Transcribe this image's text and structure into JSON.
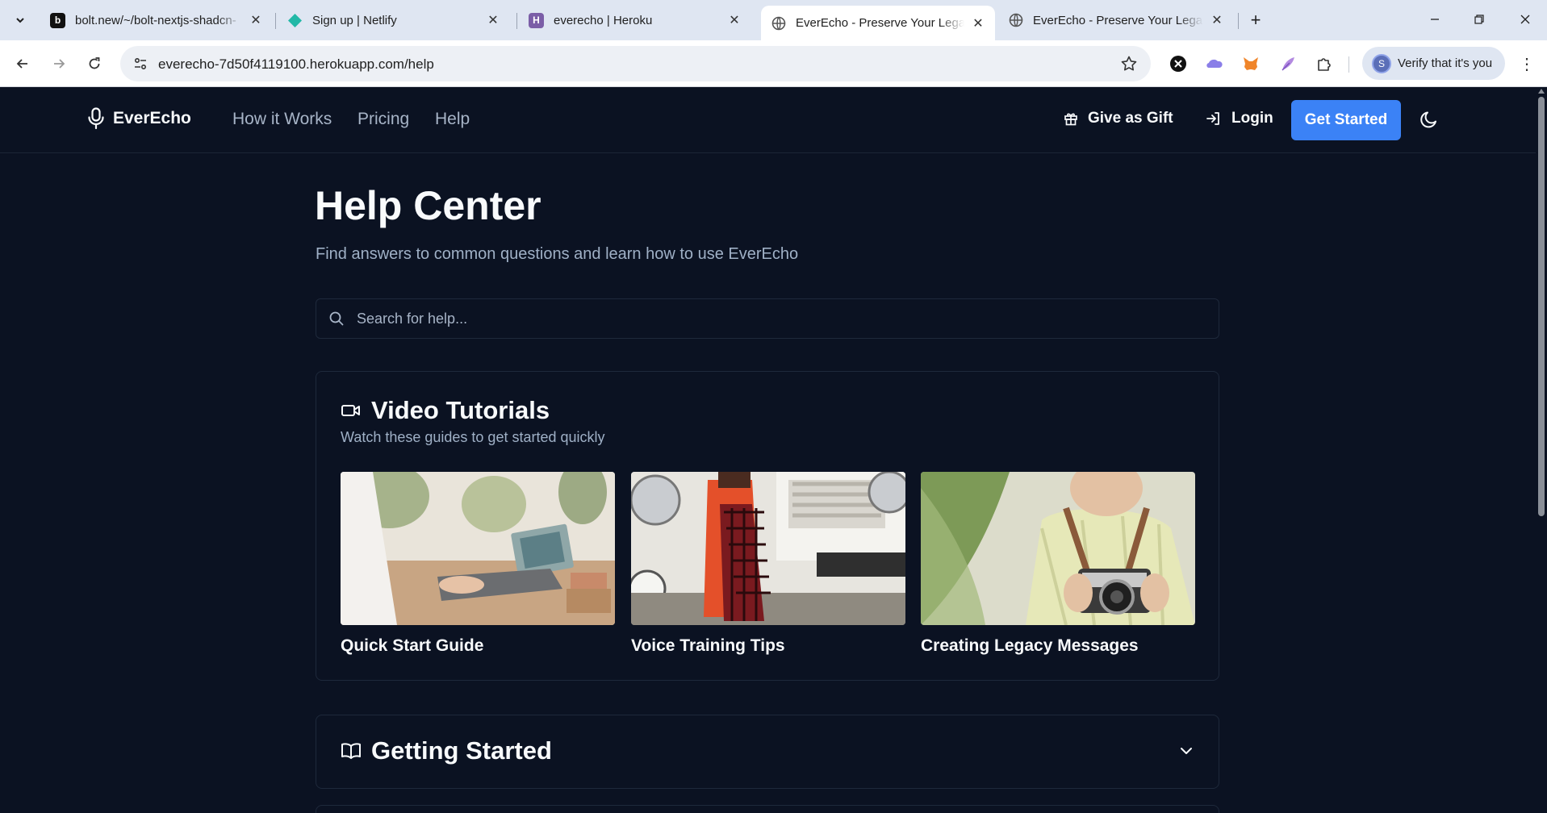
{
  "browser": {
    "tabs": [
      {
        "title": "bolt.new/~/bolt-nextjs-shadcn-",
        "favicon": "bolt-icon",
        "favicon_text": "b"
      },
      {
        "title": "Sign up | Netlify",
        "favicon": "netlify-icon"
      },
      {
        "title": "everecho | Heroku",
        "favicon": "heroku-icon",
        "favicon_text": "H"
      },
      {
        "title": "EverEcho - Preserve Your Legacy",
        "favicon": "globe-icon",
        "active": true
      },
      {
        "title": "EverEcho - Preserve Your Legacy",
        "favicon": "globe-icon"
      }
    ],
    "url": "everecho-7d50f4119100.herokuapp.com/help",
    "profile_label": "Verify that it's you",
    "profile_initial": "S"
  },
  "site": {
    "brand": "EverEcho",
    "nav": [
      "How it Works",
      "Pricing",
      "Help"
    ],
    "gift_label": "Give as Gift",
    "login_label": "Login",
    "cta_label": "Get Started"
  },
  "help": {
    "title": "Help Center",
    "subtitle": "Find answers to common questions and learn how to use EverEcho",
    "search_placeholder": "Search for help...",
    "tutorials": {
      "heading": "Video Tutorials",
      "subheading": "Watch these guides to get started quickly",
      "videos": [
        {
          "title": "Quick Start Guide"
        },
        {
          "title": "Voice Training Tips"
        },
        {
          "title": "Creating Legacy Messages"
        }
      ]
    },
    "sections": [
      {
        "heading": "Getting Started"
      }
    ]
  },
  "colors": {
    "background": "#0b1222",
    "accent": "#3b82f6",
    "text": "#f8fafc",
    "muted": "#9fb0c6"
  }
}
